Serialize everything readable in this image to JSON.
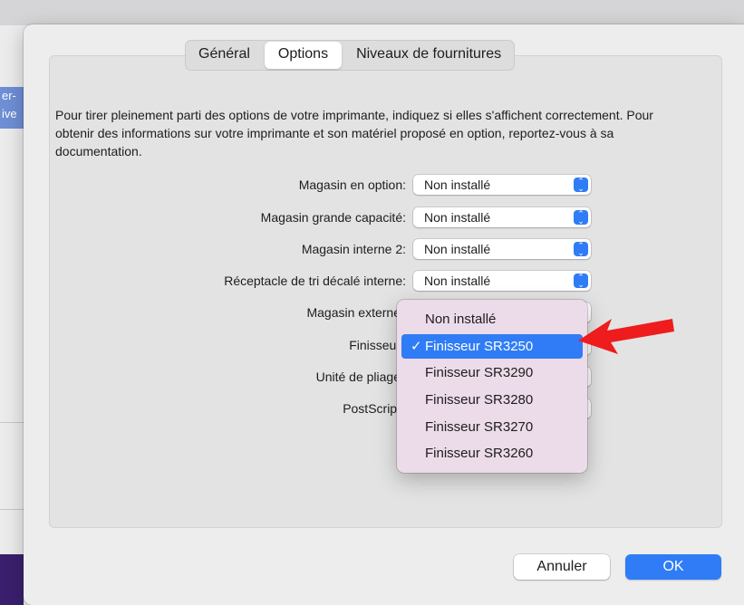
{
  "backdrop": {
    "peek_text": "er-\nive"
  },
  "tabs": [
    {
      "label": "Général",
      "active": false
    },
    {
      "label": "Options",
      "active": true
    },
    {
      "label": "Niveaux de fournitures",
      "active": false
    }
  ],
  "description": "Pour tirer pleinement parti des options de votre imprimante, indiquez si elles s'affichent correctement. Pour obtenir des informations sur votre imprimante et son matériel proposé en option, reportez-vous à sa documentation.",
  "options": [
    {
      "label": "Magasin en option:",
      "value": "Non installé"
    },
    {
      "label": "Magasin grande capacité:",
      "value": "Non installé"
    },
    {
      "label": "Magasin interne 2:",
      "value": "Non installé"
    },
    {
      "label": "Réceptacle de tri décalé interne:",
      "value": "Non installé"
    },
    {
      "label": "Magasin externe",
      "value": ""
    },
    {
      "label": "Finisseur",
      "value": ""
    },
    {
      "label": "Unité de pliage",
      "value": ""
    },
    {
      "label": "PostScript",
      "value": ""
    }
  ],
  "menu": {
    "items": [
      {
        "label": "Non installé",
        "selected": false
      },
      {
        "label": "Finisseur SR3250",
        "selected": true
      },
      {
        "label": "Finisseur SR3290",
        "selected": false
      },
      {
        "label": "Finisseur SR3280",
        "selected": false
      },
      {
        "label": "Finisseur SR3270",
        "selected": false
      },
      {
        "label": "Finisseur SR3260",
        "selected": false
      }
    ],
    "check_glyph": "✓"
  },
  "buttons": {
    "cancel": "Annuler",
    "ok": "OK"
  },
  "colors": {
    "accent": "#2f7cf6",
    "arrow": "#ee1c1c",
    "menu_bg": "#ecdbe8"
  }
}
